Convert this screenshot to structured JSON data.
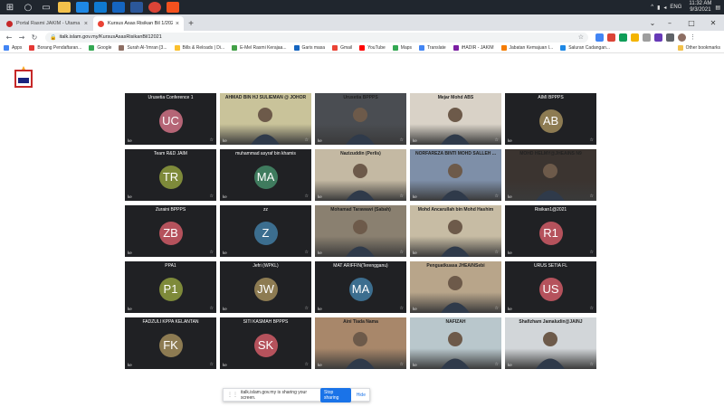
{
  "taskbar": {
    "lang": "ENG",
    "time": "11:32 AM",
    "date": "9/3/2021"
  },
  "tabs": [
    {
      "title": "Portal Rasmi JAKIM - Utama",
      "color": "#c62828"
    },
    {
      "title": "Kursus Asas Risikan Bil 1/2021",
      "color": "#5f6368"
    }
  ],
  "address": {
    "url": "italk.islam.gov.my/KursusAsasRisikanBil12021"
  },
  "bookmarks": [
    {
      "label": "Apps",
      "color": "#4285f4"
    },
    {
      "label": "Borang Pendaftaran...",
      "color": "#e53935"
    },
    {
      "label": "Google",
      "color": "#34a853"
    },
    {
      "label": "Surah Al-'Imran [3...",
      "color": "#8d6e63"
    },
    {
      "label": "Bills & Reloads | Di...",
      "color": "#fbc02d"
    },
    {
      "label": "E-Mel Rasmi Kerajaa...",
      "color": "#43a047"
    },
    {
      "label": "Garis masa",
      "color": "#1565c0"
    },
    {
      "label": "Gmail",
      "color": "#ea4335"
    },
    {
      "label": "YouTube",
      "color": "#ff0000"
    },
    {
      "label": "Maps",
      "color": "#34a853"
    },
    {
      "label": "Translate",
      "color": "#4285f4"
    },
    {
      "label": "iHADIR - JAKIM",
      "color": "#7b1fa2"
    },
    {
      "label": "Jabatan Kemajuan I...",
      "color": "#f57c00"
    },
    {
      "label": "Saluran Cadangan...",
      "color": "#1e88e5"
    }
  ],
  "other_bookmarks": "Other bookmarks",
  "participants": [
    {
      "name": "Urusetia Conference 1",
      "initials": "UC",
      "color": "#b56576",
      "kind": "avatar"
    },
    {
      "name": "AHMAD BIN HJ SULIEMAN @ JOHOR",
      "initials": "",
      "color": "#c9c39a",
      "kind": "video"
    },
    {
      "name": "Urusetia BPPPS",
      "initials": "",
      "color": "#4a4d52",
      "kind": "video"
    },
    {
      "name": "Mejar Mohd ABS",
      "initials": "",
      "color": "#d9d2c7",
      "kind": "video"
    },
    {
      "name": "AIMI BPPPS",
      "initials": "AB",
      "color": "#8d7b52",
      "kind": "avatar"
    },
    {
      "name": "Team R&D JAIM",
      "initials": "TR",
      "color": "#7e8a3a",
      "kind": "avatar"
    },
    {
      "name": "muhammad asyraf bin khamis",
      "initials": "MA",
      "color": "#3f7b5e",
      "kind": "avatar"
    },
    {
      "name": "Nazizuddin (Perlis)",
      "initials": "",
      "color": "#c4b9a3",
      "kind": "video"
    },
    {
      "name": "NORFAREZA BINTI MOHD SALLEH ...",
      "initials": "",
      "color": "#7e8fa8",
      "kind": "video"
    },
    {
      "name": "MOHD HELMY@JHEAINS N9",
      "initials": "",
      "color": "#3b3430",
      "kind": "video"
    },
    {
      "name": "Zuraini BPPPS",
      "initials": "ZB",
      "color": "#b5525c",
      "kind": "avatar"
    },
    {
      "name": "zz",
      "initials": "Z",
      "color": "#3c6e8f",
      "kind": "avatar"
    },
    {
      "name": "Mohamad Tarawawi (Sabah)",
      "initials": "",
      "color": "#8a8070",
      "kind": "video"
    },
    {
      "name": "Mohd Ancarullah bin Mohd Hashim",
      "initials": "",
      "color": "#c7bca4",
      "kind": "video"
    },
    {
      "name": "Risikan1@2021",
      "initials": "R1",
      "color": "#b5525c",
      "kind": "avatar"
    },
    {
      "name": "PPA1",
      "initials": "P1",
      "color": "#7e8a3a",
      "kind": "avatar"
    },
    {
      "name": "Jefri (WPKL)",
      "initials": "JW",
      "color": "#8d7b52",
      "kind": "avatar"
    },
    {
      "name": "MAT ARIFFIN(Terengganu)",
      "initials": "MA",
      "color": "#3c6e8f",
      "kind": "avatar"
    },
    {
      "name": "Penguatkuasa JHEAINSebi",
      "initials": "",
      "color": "#b8a58a",
      "kind": "video"
    },
    {
      "name": "URUS SETIA FL",
      "initials": "US",
      "color": "#b5525c",
      "kind": "avatar"
    },
    {
      "name": "FADZULI KPPA KELANTAN",
      "initials": "FK",
      "color": "#8d7b52",
      "kind": "avatar"
    },
    {
      "name": "SITI KASMAH BPPPS",
      "initials": "SK",
      "color": "#b5525c",
      "kind": "avatar"
    },
    {
      "name": "Aini Tiada Nama",
      "initials": "",
      "color": "#a8876a",
      "kind": "video"
    },
    {
      "name": "NAFIZAH",
      "initials": "",
      "color": "#b9c7cc",
      "kind": "video"
    },
    {
      "name": "Shafizham Jamaludin@JAINJ",
      "initials": "",
      "color": "#d2d6d9",
      "kind": "video"
    }
  ],
  "tile_badge": "ke",
  "share": {
    "message": "italk.islam.gov.my is sharing your screen.",
    "stop_label": "Stop sharing",
    "hide_label": "Hide"
  }
}
